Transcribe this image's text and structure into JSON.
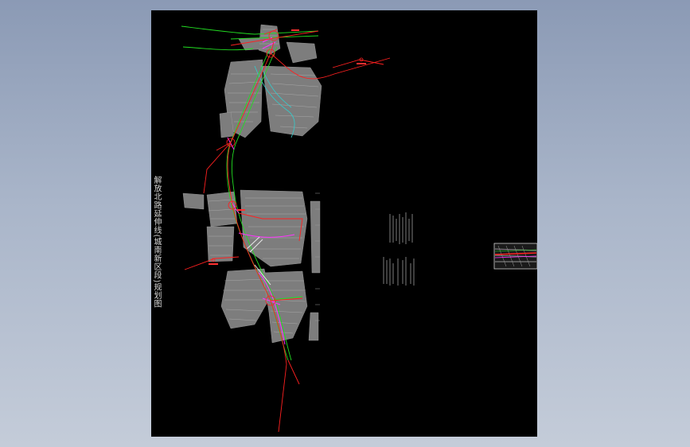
{
  "drawing": {
    "title": "解放北路延伸线(城南新区段)规划图",
    "background_color": "#000000",
    "line_colors": {
      "road_centerline": "#ff2020",
      "road_edge": "#22dd22",
      "ramp": "#ff33ff",
      "river": "#33cccc",
      "parcels": "#8a8a8a"
    }
  }
}
